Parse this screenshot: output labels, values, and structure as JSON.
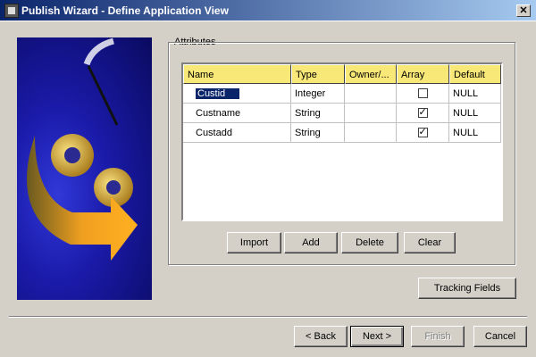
{
  "window": {
    "title": "Publish Wizard - Define Application View",
    "close_glyph": "✕"
  },
  "attributes": {
    "legend": "Attributes",
    "columns": [
      "Name",
      "Type",
      "Owner/...",
      "Array",
      "Default"
    ],
    "rows": [
      {
        "name": "Custid",
        "type": "Integer",
        "owner": "",
        "array": false,
        "default": "NULL",
        "selected": true
      },
      {
        "name": "Custname",
        "type": "String",
        "owner": "",
        "array": true,
        "default": "NULL",
        "selected": false
      },
      {
        "name": "Custadd",
        "type": "String",
        "owner": "",
        "array": true,
        "default": "NULL",
        "selected": false
      }
    ]
  },
  "actions": {
    "import": "Import",
    "add": "Add",
    "delete": "Delete",
    "clear": "Clear"
  },
  "tracking_fields": "Tracking Fields",
  "nav": {
    "back": "< Back",
    "next": "Next >",
    "finish": "Finish",
    "cancel": "Cancel"
  },
  "colors": {
    "title_start": "#0a246a",
    "header_bg": "#f8e878",
    "selection": "#0a246a",
    "banner": "#1a1aa8"
  },
  "icons": {
    "app": "app-icon",
    "close": "close-icon",
    "check": "check-icon"
  }
}
